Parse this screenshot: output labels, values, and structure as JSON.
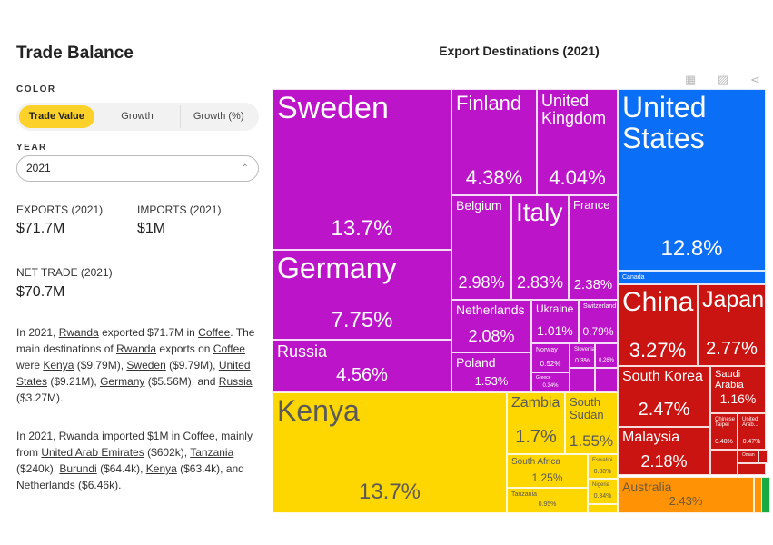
{
  "sidebar": {
    "title": "Trade Balance",
    "color_label": "COLOR",
    "color_options": [
      "Trade Value",
      "Growth",
      "Growth (%)"
    ],
    "color_selected": "Trade Value",
    "year_label": "YEAR",
    "year_value": "2021",
    "exports_label": "EXPORTS (2021)",
    "exports_value": "$71.7M",
    "imports_label": "IMPORTS (2021)",
    "imports_value": "$1M",
    "net_label": "NET TRADE (2021)",
    "net_value": "$70.7M",
    "p1": [
      "In 2021, ",
      "Rwanda",
      " exported $71.7M in ",
      "Coffee",
      ". The main destinations of ",
      "Rwanda",
      " exports on ",
      "Coffee",
      " were ",
      "Kenya",
      " ($9.79M), ",
      "Sweden",
      " ($9.79M), ",
      "United States",
      " ($9.21M), ",
      "Germany",
      " ($5.56M), and ",
      "Russia",
      " ($3.27M)."
    ],
    "p2": [
      "In 2021, ",
      "Rwanda",
      " imported $1M in ",
      "Coffee",
      ", mainly from ",
      "United Arab Emirates",
      " ($602k), ",
      "Tanzania",
      " ($240k), ",
      "Burundi",
      " ($64.4k), ",
      "Kenya",
      " ($63.4k), and ",
      "Netherlands",
      " ($6.46k)."
    ]
  },
  "chart_data": {
    "type": "treemap",
    "title": "Export Destinations (2021)",
    "colors": {
      "Europe": "#bb14c9",
      "North America": "#0b6ef6",
      "Asia": "#c91411",
      "Africa": "#fed700",
      "Oceania": "#ff9305",
      "South America": "#1aaa44"
    },
    "tiles": [
      {
        "name": "Sweden",
        "value": "13.7%"
      },
      {
        "name": "Germany",
        "value": "7.75%"
      },
      {
        "name": "Russia",
        "value": "4.56%"
      },
      {
        "name": "Finland",
        "value": "4.38%"
      },
      {
        "name": "United Kingdom",
        "value": "4.04%"
      },
      {
        "name": "Belgium",
        "value": "2.98%"
      },
      {
        "name": "Italy",
        "value": "2.83%"
      },
      {
        "name": "France",
        "value": "2.38%"
      },
      {
        "name": "Netherlands",
        "value": "2.08%"
      },
      {
        "name": "Ukraine",
        "value": "1.01%"
      },
      {
        "name": "Switzerland",
        "value": "0.79%"
      },
      {
        "name": "Poland",
        "value": "1.53%"
      },
      {
        "name": "Norway",
        "value": "0.52%"
      },
      {
        "name": "Slovenia",
        "value": "0.3%"
      },
      {
        "name": "",
        "value": "0.26%"
      },
      {
        "name": "Greece",
        "value": "0.34%"
      },
      {
        "name": "Kenya",
        "value": "13.7%"
      },
      {
        "name": "Zambia",
        "value": "1.7%"
      },
      {
        "name": "South Sudan",
        "value": "1.55%"
      },
      {
        "name": "South Africa",
        "value": "1.25%"
      },
      {
        "name": "Eswatini",
        "value": "0.38%"
      },
      {
        "name": "Nigeria",
        "value": "0.34%"
      },
      {
        "name": "Tanzania",
        "value": "0.95%"
      },
      {
        "name": "United States",
        "value": "12.8%"
      },
      {
        "name": "Canada",
        "value": ""
      },
      {
        "name": "China",
        "value": "3.27%"
      },
      {
        "name": "Japan",
        "value": "2.77%"
      },
      {
        "name": "South Korea",
        "value": "2.47%"
      },
      {
        "name": "Malaysia",
        "value": "2.18%"
      },
      {
        "name": "Saudi Arabia",
        "value": "1.16%"
      },
      {
        "name": "Chinese Taipei",
        "value": "0.48%"
      },
      {
        "name": "United Arab...",
        "value": "0.47%"
      },
      {
        "name": "Oman",
        "value": ""
      },
      {
        "name": "Australia",
        "value": "2.43%"
      }
    ]
  }
}
